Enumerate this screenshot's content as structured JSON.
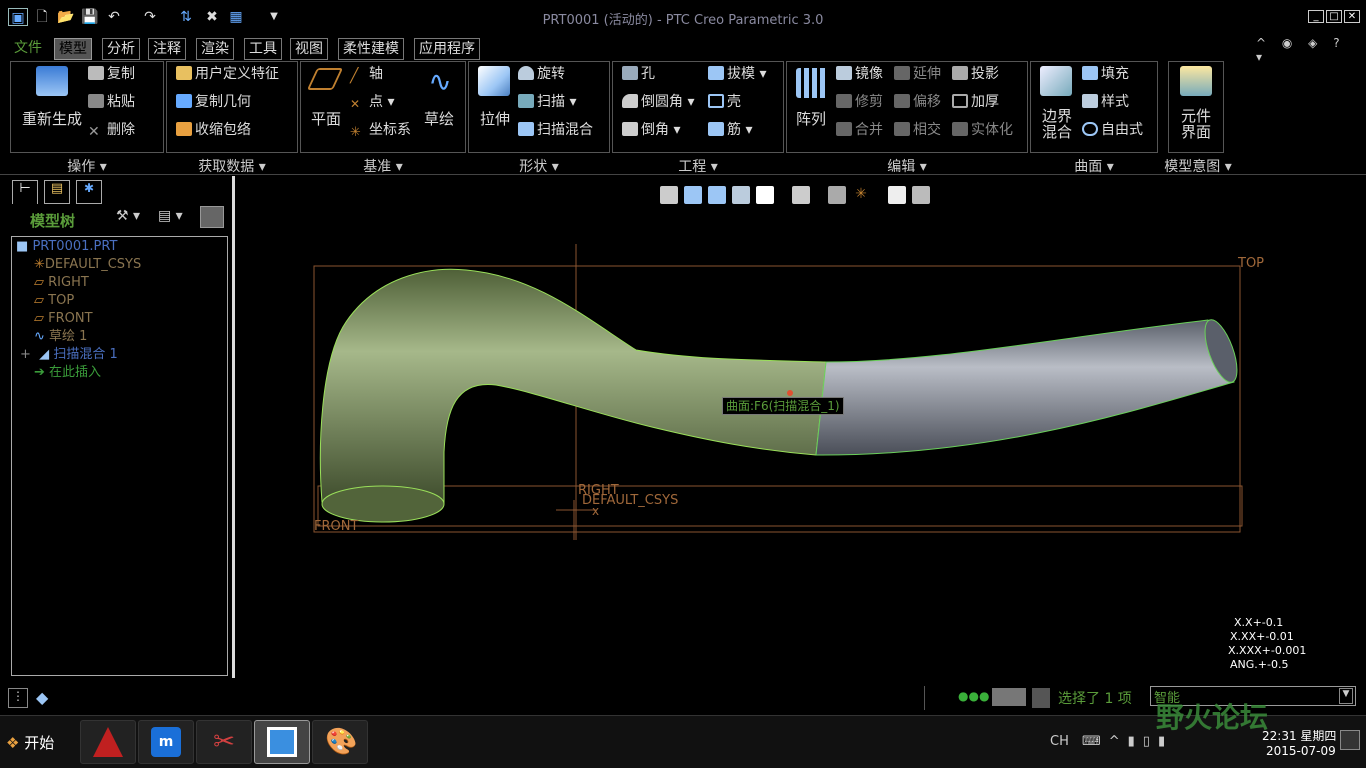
{
  "window": {
    "title": "PRT0001 (活动的) - PTC Creo Parametric 3.0"
  },
  "tabs": [
    {
      "label": "文件"
    },
    {
      "label": "模型"
    },
    {
      "label": "分析"
    },
    {
      "label": "注释"
    },
    {
      "label": "渲染"
    },
    {
      "label": "工具"
    },
    {
      "label": "视图"
    },
    {
      "label": "柔性建模"
    },
    {
      "label": "应用程序"
    }
  ],
  "ribbon": {
    "operations": {
      "regen": "重新生成",
      "copy": "复制",
      "paste": "粘贴",
      "delete": "删除",
      "group": "操作"
    },
    "getdata": {
      "udf": "用户定义特征",
      "copygeom": "复制几何",
      "shrinkwrap": "收缩包络",
      "group": "获取数据"
    },
    "datum": {
      "plane": "平面",
      "axis": "轴",
      "point": "点",
      "csys": "坐标系",
      "sketch": "草绘",
      "group": "基准"
    },
    "shapes": {
      "extrude": "拉伸",
      "revolve": "旋转",
      "sweep": "扫描",
      "sweptblend": "扫描混合",
      "group": "形状"
    },
    "engineering": {
      "hole": "孔",
      "round": "倒圆角",
      "chamfer": "倒角",
      "draft": "拔模",
      "shell": "壳",
      "rib": "筋",
      "group": "工程"
    },
    "editing": {
      "pattern": "阵列",
      "mirror": "镜像",
      "trim": "修剪",
      "merge": "合并",
      "extend": "延伸",
      "offset": "偏移",
      "intersect": "相交",
      "project": "投影",
      "thicken": "加厚",
      "solidify": "实体化",
      "group": "编辑"
    },
    "surfaces": {
      "boundary": "边界\n混合",
      "fill": "填充",
      "style": "样式",
      "freestyle": "自由式",
      "group": "曲面"
    },
    "intent": {
      "component": "元件\n界面",
      "group": "模型意图"
    }
  },
  "model_tree": {
    "title": "模型树",
    "items": [
      {
        "label": "PRT0001.PRT",
        "color": "#4a6fbf"
      },
      {
        "label": "DEFAULT_CSYS",
        "color": "#8a7550"
      },
      {
        "label": "RIGHT",
        "color": "#8a7550"
      },
      {
        "label": "TOP",
        "color": "#8a7550"
      },
      {
        "label": "FRONT",
        "color": "#8a7550"
      },
      {
        "label": "草绘 1",
        "color": "#8a7550"
      },
      {
        "label": "扫描混合 1",
        "color": "#4a6fbf"
      },
      {
        "label": "在此插入",
        "color": "#3a9c3a"
      }
    ]
  },
  "viewport": {
    "label_top": "TOP",
    "label_right": "RIGHT",
    "label_front": "FRONT",
    "label_csys": "DEFAULT_CSYS",
    "label_x": "x",
    "tooltip": "曲面:F6(扫描混合_1)"
  },
  "tolerances": [
    "X.X+-0.1",
    "X.XX+-0.01",
    "X.XXX+-0.001",
    "ANG.+-0.5"
  ],
  "status": {
    "selected": "选择了 1 项",
    "filter": "智能"
  },
  "taskbar": {
    "start": "开始",
    "lang": "CH",
    "time": "22:31 星期四",
    "date": "2015-07-09",
    "watermark": "野火论坛"
  },
  "colors": {
    "accent": "#5a9c3a",
    "part_green": "#7b8f5e",
    "part_grey": "#8a8f9a",
    "datum": "#a0683a"
  }
}
